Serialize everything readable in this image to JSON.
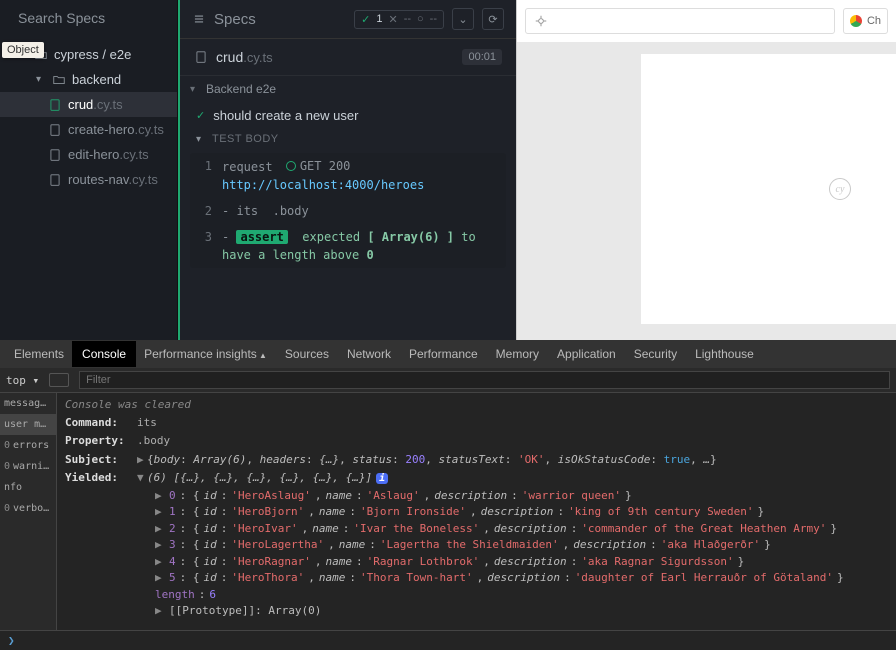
{
  "sidebar": {
    "search_placeholder": "Search Specs",
    "tooltip": "Object",
    "tree": {
      "root": {
        "label": "cypress / e2e"
      },
      "folder": {
        "label": "backend"
      },
      "files": [
        {
          "name": "crud",
          "ext": ".cy.ts",
          "active": true
        },
        {
          "name": "create-hero",
          "ext": ".cy.ts",
          "active": false
        },
        {
          "name": "edit-hero",
          "ext": ".cy.ts",
          "active": false
        },
        {
          "name": "routes-nav",
          "ext": ".cy.ts",
          "active": false
        }
      ]
    }
  },
  "cmdlog": {
    "title": "Specs",
    "stats": {
      "pass": "1",
      "fail": "--",
      "pending": "--"
    },
    "spec": {
      "name": "crud",
      "ext": ".cy.ts",
      "time": "00:01"
    },
    "suite": "Backend e2e",
    "test": "should create a new user",
    "section": "TEST BODY",
    "steps": {
      "s1": {
        "num": "1",
        "cmd": "request",
        "method": "GET",
        "status": "200",
        "url": "http://localhost:4000/heroes"
      },
      "s2": {
        "num": "2",
        "dash": "-",
        "cmd": "its",
        "arg": ".body"
      },
      "s3": {
        "num": "3",
        "dash": "-",
        "badge": "assert",
        "pre": "expected ",
        "val": "[ Array(6) ]",
        "mid": " to have a length above ",
        "tail": "0"
      }
    }
  },
  "preview": {
    "browser": "Ch",
    "watermark": "cy"
  },
  "devtools": {
    "tabs": [
      "Elements",
      "Console",
      "Performance insights",
      "Sources",
      "Network",
      "Performance",
      "Memory",
      "Application",
      "Security",
      "Lighthouse"
    ],
    "active_tab": 1,
    "context": "top ▾",
    "filter_placeholder": "Filter",
    "sidebar_items": [
      {
        "count": "",
        "label": "messages"
      },
      {
        "count": "",
        "label": "user mes…"
      },
      {
        "count": "0",
        "label": "errors"
      },
      {
        "count": "0",
        "label": "warnings"
      },
      {
        "count": "",
        "label": "nfo"
      },
      {
        "count": "0",
        "label": "verbose"
      }
    ],
    "active_sidebar": 1,
    "cleared": "Console was cleared",
    "rows": {
      "command_label": "Command:",
      "command_val": "its",
      "property_label": "Property:",
      "property_val": ".body",
      "subject_label": "Subject:",
      "yielded_label": "Yielded:"
    },
    "subject": {
      "body_key": "body",
      "body_val": "Array(6)",
      "headers_key": "headers",
      "headers_val": "{…}",
      "status_key": "status",
      "status_val": "200",
      "statusText_key": "statusText",
      "statusText_val": "'OK'",
      "isOk_key": "isOkStatusCode",
      "isOk_val": "true",
      "ellipsis": "…"
    },
    "yielded_header": "(6) [{…}, {…}, {…}, {…}, {…}, {…}]",
    "heroes": [
      {
        "idx": "0",
        "id": "'HeroAslaug'",
        "name": "'Aslaug'",
        "desc": "'warrior queen'"
      },
      {
        "idx": "1",
        "id": "'HeroBjorn'",
        "name": "'Bjorn Ironside'",
        "desc": "'king of 9th century Sweden'"
      },
      {
        "idx": "2",
        "id": "'HeroIvar'",
        "name": "'Ivar the Boneless'",
        "desc": "'commander of the Great Heathen Army'"
      },
      {
        "idx": "3",
        "id": "'HeroLagertha'",
        "name": "'Lagertha the Shieldmaiden'",
        "desc": "'aka Hlaðgerðr'"
      },
      {
        "idx": "4",
        "id": "'HeroRagnar'",
        "name": "'Ragnar Lothbrok'",
        "desc": "'aka Ragnar Sigurdsson'"
      },
      {
        "idx": "5",
        "id": "'HeroThora'",
        "name": "'Thora Town-hart'",
        "desc": "'daughter of Earl Herrauðr of Götaland'"
      }
    ],
    "length_key": "length",
    "length_val": "6",
    "proto": "[[Prototype]]: Array(0)",
    "keys": {
      "id": "id",
      "name": "name",
      "description": "description"
    }
  }
}
